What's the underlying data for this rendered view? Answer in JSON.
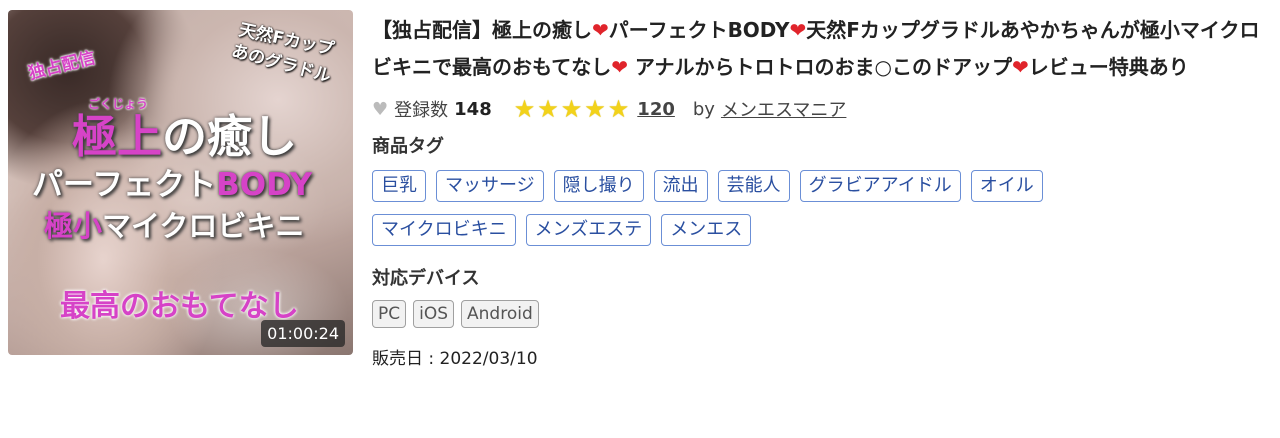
{
  "thumbnail": {
    "overlay_lines": {
      "dokusen": "独占配信",
      "tennen": "天然Fカップ",
      "ano": "あのグラドル",
      "gokujo_ruby": "ごくじょう",
      "gokujo_pink": "極上",
      "gokujo_rest": "の癒し",
      "perfect_white": "パーフェクト",
      "perfect_pink": "BODY",
      "micro_pink": "極小",
      "micro_rest": "マイクロビキニ",
      "saiko": "最高のおもてなし"
    },
    "duration": "01:00:24"
  },
  "product": {
    "title_parts": {
      "p1": "【独占配信】極上の癒し",
      "p2": "パーフェクトBODY",
      "p3": "天然Fカップグラドルあやかちゃんが極小マイクロビキニで最高のおもてなし",
      "p4": " アナルからトロトロのおま○このドアップ",
      "p5": "レビュー特典あり"
    },
    "heart_glyph": "❤",
    "favorites_label": "登録数",
    "favorites_count": "148",
    "rating_stars": 5,
    "review_count": "120",
    "by_label": "by",
    "maker": "メンエスマニア",
    "tags_label": "商品タグ",
    "tags": [
      "巨乳",
      "マッサージ",
      "隠し撮り",
      "流出",
      "芸能人",
      "グラビアアイドル",
      "オイル",
      "マイクロビキニ",
      "メンズエステ",
      "メンエス"
    ],
    "devices_label": "対応デバイス",
    "devices": [
      "PC",
      "iOS",
      "Android"
    ],
    "release_label": "販売日 : ",
    "release_date": "2022/03/10"
  },
  "colors": {
    "heart": "#e0242b",
    "star": "#f2d21a",
    "tag_border": "#6b8fd6",
    "tag_text": "#2a4fa0",
    "thumb_pink": "#e23ed1"
  }
}
